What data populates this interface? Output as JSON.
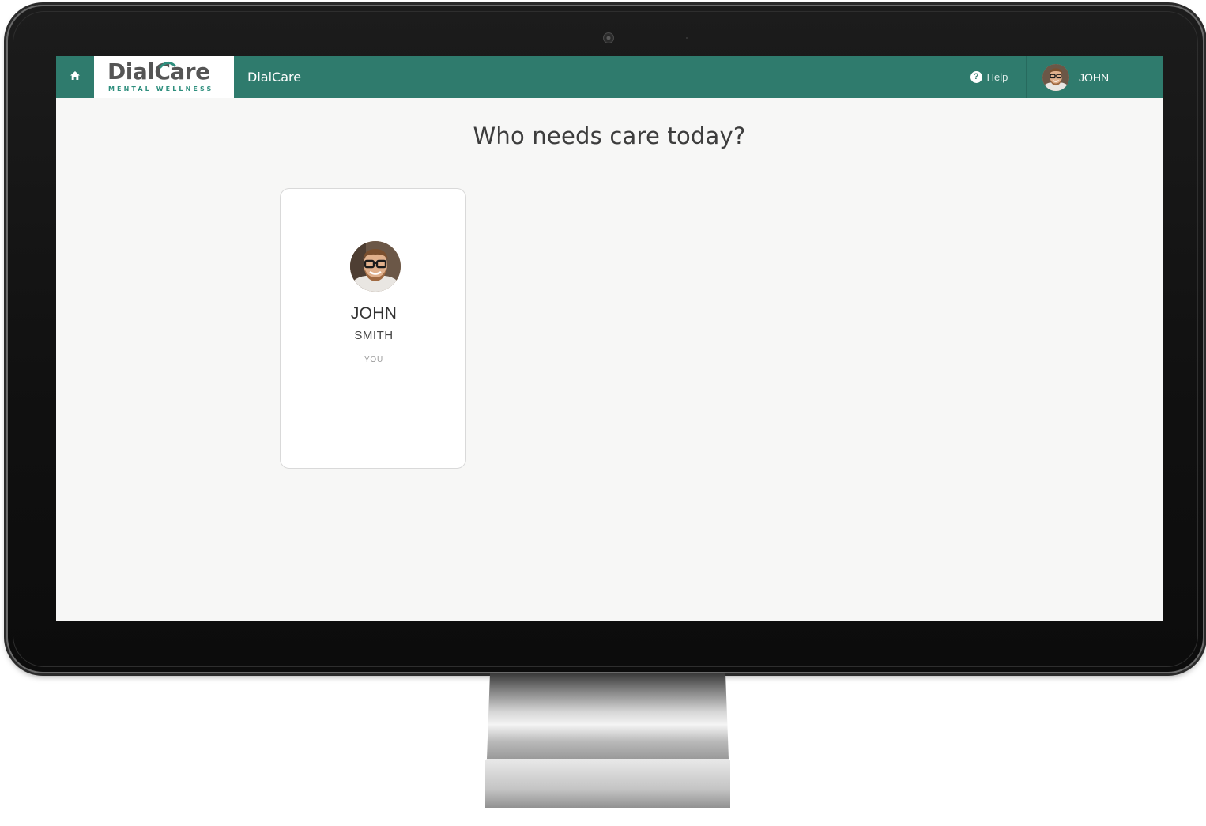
{
  "brand": {
    "logo_text": "DialCare",
    "logo_tagline": "MENTAL WELLNESS",
    "accent_color": "#2f7b6d",
    "tagline_color": "#2f8f7e"
  },
  "header": {
    "home_icon": "home-icon",
    "app_title": "DialCare",
    "help_label": "Help",
    "help_icon": "question-circle-icon",
    "user_name": "JOHN"
  },
  "main": {
    "title": "Who needs care today?",
    "people": [
      {
        "first_name": "JOHN",
        "last_name": "SMITH",
        "relation": "YOU"
      }
    ]
  }
}
